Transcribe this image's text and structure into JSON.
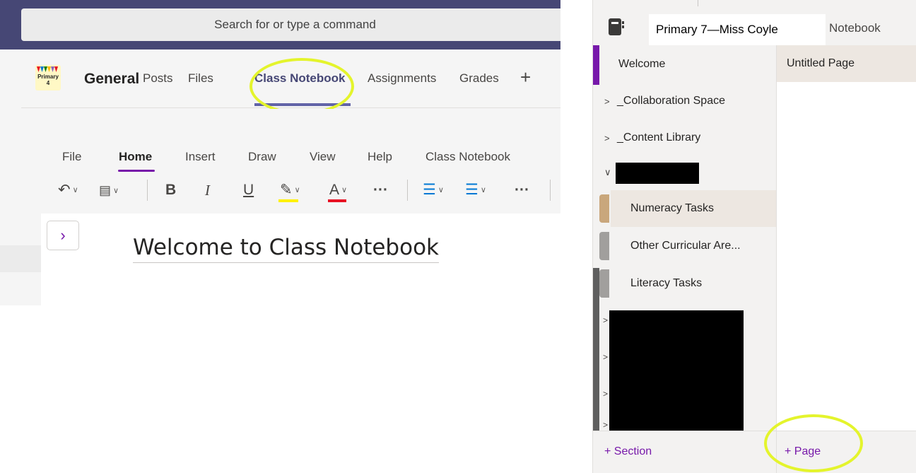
{
  "left": {
    "search_placeholder": "Search for or type a command",
    "team": {
      "logo_text": "Primary 4",
      "name": "General"
    },
    "tabs": [
      "Posts",
      "Files",
      "Class Notebook",
      "Assignments",
      "Grades"
    ],
    "add_tab_icon": "+",
    "ribbon_tabs": [
      "File",
      "Home",
      "Insert",
      "Draw",
      "View",
      "Help",
      "Class Notebook"
    ],
    "active_ribbon_tab": "Home",
    "tools": {
      "undo_icon": "↶",
      "clipboard_icon": "📋",
      "bold": "B",
      "italic": "I",
      "underline": "U",
      "highlighter_icon": "✎",
      "font_color": "A",
      "more": "···",
      "bullets_icon": "☰",
      "numbering_icon": "☰",
      "more2": "···"
    },
    "highlight_color": "#fff100",
    "font_color_value": "#e81123",
    "expand_icon": "›",
    "page_title": "Welcome to Class Notebook"
  },
  "right": {
    "notebook_name": "Primary 7—Miss Coyle",
    "notebook_label": "Notebook",
    "sections": [
      {
        "label": "Welcome",
        "expandable": false
      },
      {
        "label": "_Collaboration Space",
        "expandable": true
      },
      {
        "label": "_Content Library",
        "expandable": true
      }
    ],
    "subsections": [
      {
        "label": "Numeracy Tasks",
        "tab_color": "#c9a77c",
        "selected": true
      },
      {
        "label": "Other Curricular Are...",
        "tab_color": "#a19f9d",
        "selected": false
      },
      {
        "label": "Literacy Tasks",
        "tab_color": "#a19f9d",
        "selected": false
      }
    ],
    "pages": [
      "Untitled Page"
    ],
    "add_section": "+ Section",
    "add_page": "+ Page",
    "accent_color": "#7719aa"
  }
}
